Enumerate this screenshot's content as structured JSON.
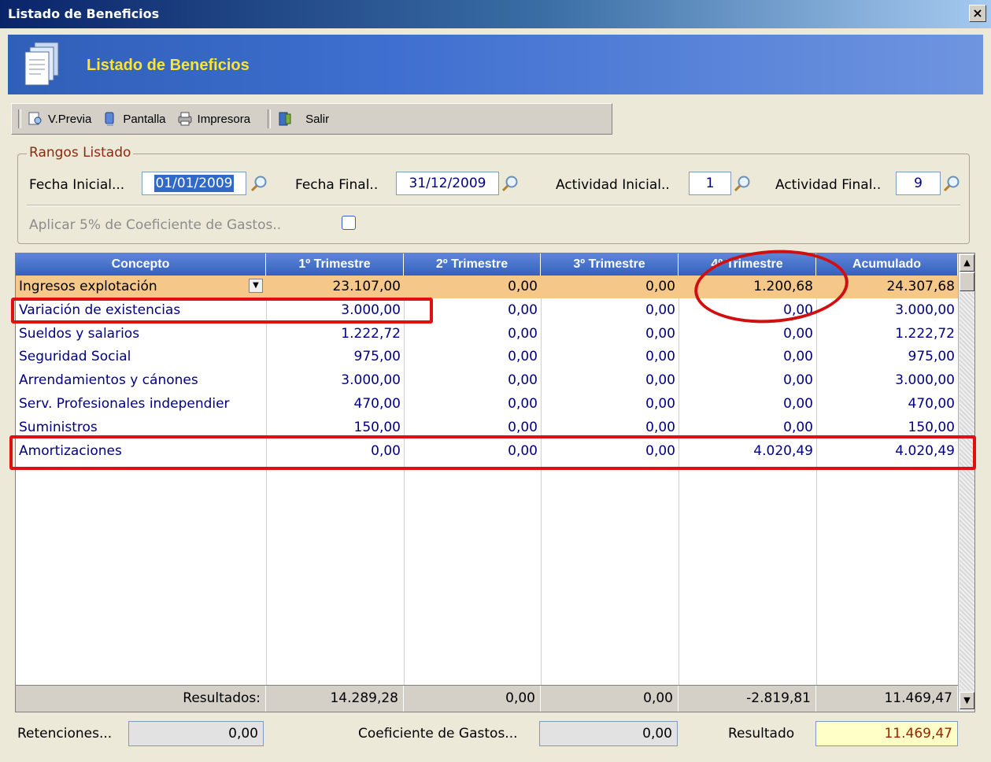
{
  "window": {
    "title": "Listado de Beneficios",
    "close_label": "×"
  },
  "banner": {
    "title": "Listado de Beneficios"
  },
  "toolbar": {
    "preview_label": "V.Previa",
    "screen_label": "Pantalla",
    "printer_label": "Impresora",
    "exit_label": "Salir"
  },
  "ranges": {
    "legend": "Rangos Listado",
    "fecha_inicial_label": "Fecha Inicial...",
    "fecha_inicial_value": "01/01/2009",
    "fecha_final_label": "Fecha Final..",
    "fecha_final_value": "31/12/2009",
    "actividad_inicial_label": "Actividad Inicial..",
    "actividad_inicial_value": "1",
    "actividad_final_label": "Actividad Final..",
    "actividad_final_value": "9",
    "coef_label": "Aplicar 5% de Coeficiente de Gastos..",
    "coef_checked": false
  },
  "grid": {
    "headers": [
      "Concepto",
      "1º Trimestre",
      "2º Trimestre",
      "3º Trimestre",
      "4º Trimestre",
      "Acumulado"
    ],
    "rows": [
      [
        "Ingresos explotación",
        "23.107,00",
        "0,00",
        "0,00",
        "1.200,68",
        "24.307,68"
      ],
      [
        "Variación de existencias",
        "3.000,00",
        "0,00",
        "0,00",
        "0,00",
        "3.000,00"
      ],
      [
        "Sueldos y salarios",
        "1.222,72",
        "0,00",
        "0,00",
        "0,00",
        "1.222,72"
      ],
      [
        "Seguridad Social",
        "975,00",
        "0,00",
        "0,00",
        "0,00",
        "975,00"
      ],
      [
        "Arrendamientos y cánones",
        "3.000,00",
        "0,00",
        "0,00",
        "0,00",
        "3.000,00"
      ],
      [
        "Serv. Profesionales independier",
        "470,00",
        "0,00",
        "0,00",
        "0,00",
        "470,00"
      ],
      [
        "Suministros",
        "150,00",
        "0,00",
        "0,00",
        "0,00",
        "150,00"
      ],
      [
        "Amortizaciones",
        "0,00",
        "0,00",
        "0,00",
        "4.020,49",
        "4.020,49"
      ]
    ],
    "footer": [
      "Resultados:",
      "14.289,28",
      "0,00",
      "0,00",
      "-2.819,81",
      "11.469,47"
    ]
  },
  "summary": {
    "retenciones_label": "Retenciones...",
    "retenciones_value": "0,00",
    "coef_gastos_label": "Coeficiente de Gastos...",
    "coef_gastos_value": "0,00",
    "resultado_label": "Resultado",
    "resultado_value": "11.469,47"
  },
  "colors": {
    "header_blue": "#3561BE",
    "selected_row": "#F5C88A",
    "banner_title": "#FFE52E",
    "annotation_red": "#E01010"
  }
}
